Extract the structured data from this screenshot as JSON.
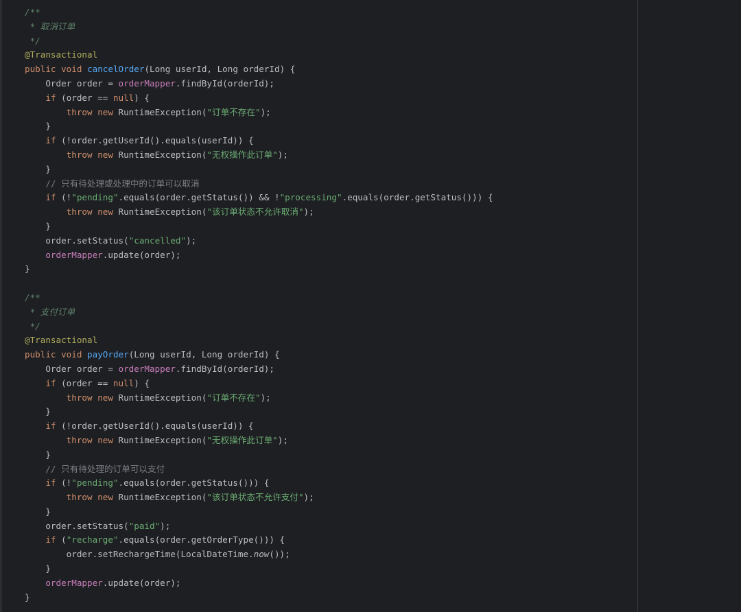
{
  "editor": {
    "theme_colors": {
      "background": "#1e1f22",
      "default_text": "#bcbec4",
      "keyword": "#cf8e6d",
      "method_declaration": "#56a8f5",
      "field": "#c77dbb",
      "string": "#6aab73",
      "line_comment": "#7a7e85",
      "doc_comment": "#5f826b",
      "annotation": "#b3ae60"
    },
    "lines": [
      [
        {
          "t": "/**",
          "c": "doc"
        }
      ],
      [
        {
          "t": " * 取消订单",
          "c": "doc"
        }
      ],
      [
        {
          "t": " */",
          "c": "doc"
        }
      ],
      [
        {
          "t": "@Transactional",
          "c": "ann"
        }
      ],
      [
        {
          "t": "public",
          "c": "kw"
        },
        {
          "t": " "
        },
        {
          "t": "void",
          "c": "kw"
        },
        {
          "t": " "
        },
        {
          "t": "cancelOrder",
          "c": "fn"
        },
        {
          "t": "(Long userId, Long orderId) {"
        }
      ],
      [
        {
          "t": "    Order order = "
        },
        {
          "t": "orderMapper",
          "c": "fld"
        },
        {
          "t": ".findById(orderId);"
        }
      ],
      [
        {
          "t": "    "
        },
        {
          "t": "if",
          "c": "kw"
        },
        {
          "t": " (order == "
        },
        {
          "t": "null",
          "c": "kw"
        },
        {
          "t": ") {"
        }
      ],
      [
        {
          "t": "        "
        },
        {
          "t": "throw",
          "c": "kw"
        },
        {
          "t": " "
        },
        {
          "t": "new",
          "c": "kw"
        },
        {
          "t": " RuntimeException("
        },
        {
          "t": "\"订单不存在\"",
          "c": "str"
        },
        {
          "t": ");"
        }
      ],
      [
        {
          "t": "    }"
        }
      ],
      [
        {
          "t": "    "
        },
        {
          "t": "if",
          "c": "kw"
        },
        {
          "t": " (!order.getUserId().equals(userId)) {"
        }
      ],
      [
        {
          "t": "        "
        },
        {
          "t": "throw",
          "c": "kw"
        },
        {
          "t": " "
        },
        {
          "t": "new",
          "c": "kw"
        },
        {
          "t": " RuntimeException("
        },
        {
          "t": "\"无权操作此订单\"",
          "c": "str"
        },
        {
          "t": ");"
        }
      ],
      [
        {
          "t": "    }"
        }
      ],
      [
        {
          "t": "    // 只有待处理或处理中的订单可以取消",
          "c": "cmt"
        }
      ],
      [
        {
          "t": "    "
        },
        {
          "t": "if",
          "c": "kw"
        },
        {
          "t": " (!"
        },
        {
          "t": "\"pending\"",
          "c": "str"
        },
        {
          "t": ".equals(order.getStatus()) && !"
        },
        {
          "t": "\"processing\"",
          "c": "str"
        },
        {
          "t": ".equals(order.getStatus())) {"
        }
      ],
      [
        {
          "t": "        "
        },
        {
          "t": "throw",
          "c": "kw"
        },
        {
          "t": " "
        },
        {
          "t": "new",
          "c": "kw"
        },
        {
          "t": " RuntimeException("
        },
        {
          "t": "\"该订单状态不允许取消\"",
          "c": "str"
        },
        {
          "t": ");"
        }
      ],
      [
        {
          "t": "    }"
        }
      ],
      [
        {
          "t": "    order.setStatus("
        },
        {
          "t": "\"cancelled\"",
          "c": "str"
        },
        {
          "t": ");"
        }
      ],
      [
        {
          "t": "    "
        },
        {
          "t": "orderMapper",
          "c": "fld"
        },
        {
          "t": ".update(order);"
        }
      ],
      [
        {
          "t": "}"
        }
      ],
      [],
      [
        {
          "t": "/**",
          "c": "doc"
        }
      ],
      [
        {
          "t": " * 支付订单",
          "c": "doc"
        }
      ],
      [
        {
          "t": " */",
          "c": "doc"
        }
      ],
      [
        {
          "t": "@Transactional",
          "c": "ann"
        }
      ],
      [
        {
          "t": "public",
          "c": "kw"
        },
        {
          "t": " "
        },
        {
          "t": "void",
          "c": "kw"
        },
        {
          "t": " "
        },
        {
          "t": "payOrder",
          "c": "fn"
        },
        {
          "t": "(Long userId, Long orderId) {"
        }
      ],
      [
        {
          "t": "    Order order = "
        },
        {
          "t": "orderMapper",
          "c": "fld"
        },
        {
          "t": ".findById(orderId);"
        }
      ],
      [
        {
          "t": "    "
        },
        {
          "t": "if",
          "c": "kw"
        },
        {
          "t": " (order == "
        },
        {
          "t": "null",
          "c": "kw"
        },
        {
          "t": ") {"
        }
      ],
      [
        {
          "t": "        "
        },
        {
          "t": "throw",
          "c": "kw"
        },
        {
          "t": " "
        },
        {
          "t": "new",
          "c": "kw"
        },
        {
          "t": " RuntimeException("
        },
        {
          "t": "\"订单不存在\"",
          "c": "str"
        },
        {
          "t": ");"
        }
      ],
      [
        {
          "t": "    }"
        }
      ],
      [
        {
          "t": "    "
        },
        {
          "t": "if",
          "c": "kw"
        },
        {
          "t": " (!order.getUserId().equals(userId)) {"
        }
      ],
      [
        {
          "t": "        "
        },
        {
          "t": "throw",
          "c": "kw"
        },
        {
          "t": " "
        },
        {
          "t": "new",
          "c": "kw"
        },
        {
          "t": " RuntimeException("
        },
        {
          "t": "\"无权操作此订单\"",
          "c": "str"
        },
        {
          "t": ");"
        }
      ],
      [
        {
          "t": "    }"
        }
      ],
      [
        {
          "t": "    // 只有待处理的订单可以支付",
          "c": "cmt"
        }
      ],
      [
        {
          "t": "    "
        },
        {
          "t": "if",
          "c": "kw"
        },
        {
          "t": " (!"
        },
        {
          "t": "\"pending\"",
          "c": "str"
        },
        {
          "t": ".equals(order.getStatus())) {"
        }
      ],
      [
        {
          "t": "        "
        },
        {
          "t": "throw",
          "c": "kw"
        },
        {
          "t": " "
        },
        {
          "t": "new",
          "c": "kw"
        },
        {
          "t": " RuntimeException("
        },
        {
          "t": "\"该订单状态不允许支付\"",
          "c": "str"
        },
        {
          "t": ");"
        }
      ],
      [
        {
          "t": "    }"
        }
      ],
      [
        {
          "t": "    order.setStatus("
        },
        {
          "t": "\"paid\"",
          "c": "str"
        },
        {
          "t": ");"
        }
      ],
      [
        {
          "t": "    "
        },
        {
          "t": "if",
          "c": "kw"
        },
        {
          "t": " ("
        },
        {
          "t": "\"recharge\"",
          "c": "str"
        },
        {
          "t": ".equals(order.getOrderType())) {"
        }
      ],
      [
        {
          "t": "        order.setRechargeTime(LocalDateTime."
        },
        {
          "t": "now",
          "c": "ital"
        },
        {
          "t": "());"
        }
      ],
      [
        {
          "t": "    }"
        }
      ],
      [
        {
          "t": "    "
        },
        {
          "t": "orderMapper",
          "c": "fld"
        },
        {
          "t": ".update(order);"
        }
      ],
      [
        {
          "t": "}"
        }
      ]
    ]
  }
}
